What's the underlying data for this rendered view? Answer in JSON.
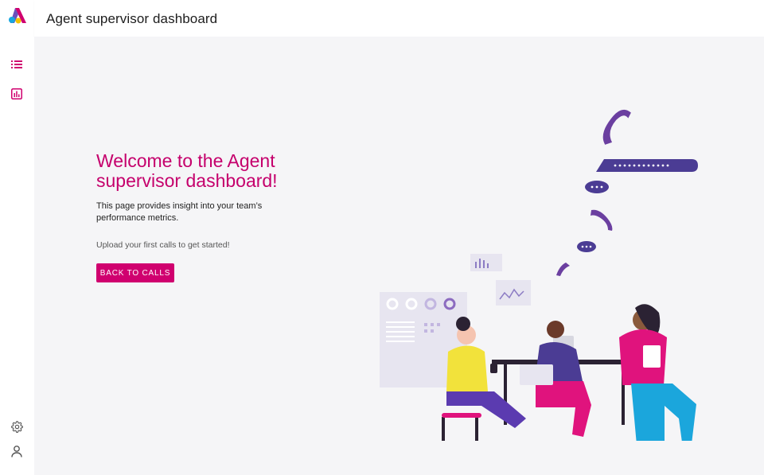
{
  "header": {
    "title": "Agent supervisor dashboard"
  },
  "sidebar": {
    "logo": "app-logo",
    "items": [
      {
        "icon": "list-icon",
        "label": ""
      },
      {
        "icon": "bar-chart-icon",
        "label": ""
      }
    ],
    "bottom_items": [
      {
        "icon": "gear-icon"
      },
      {
        "icon": "user-icon"
      }
    ]
  },
  "main": {
    "welcome_title": "Welcome to the Agent supervisor dashboard!",
    "welcome_description": "This page provides insight into your team’s performance metrics.",
    "hint": "Upload your first calls to get started!",
    "back_button_label": "BACK TO CALLS"
  },
  "colors": {
    "accent": "#d0006f",
    "title": "#c5006c",
    "icon": "#d0006f",
    "background": "#f5f5f7"
  }
}
